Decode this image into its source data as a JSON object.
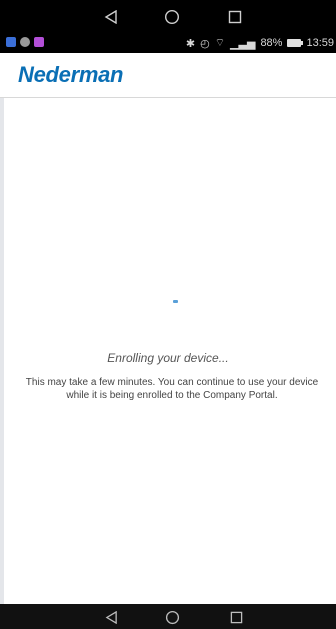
{
  "system_nav": {
    "back_icon": "back-triangle-icon",
    "home_icon": "home-circle-icon",
    "recents_icon": "recents-square-icon"
  },
  "status_bar": {
    "battery_level": "88%",
    "time": "13:59",
    "notification_colors": [
      "#3b6fd8",
      "#9a9a9a",
      "#b34fd8"
    ]
  },
  "header": {
    "brand": "Nederman",
    "brand_color": "#0a6fb5"
  },
  "main": {
    "title": "Enrolling your device...",
    "description": "This may take a few minutes. You can continue to use your device while it is being enrolled to the Company Portal."
  }
}
